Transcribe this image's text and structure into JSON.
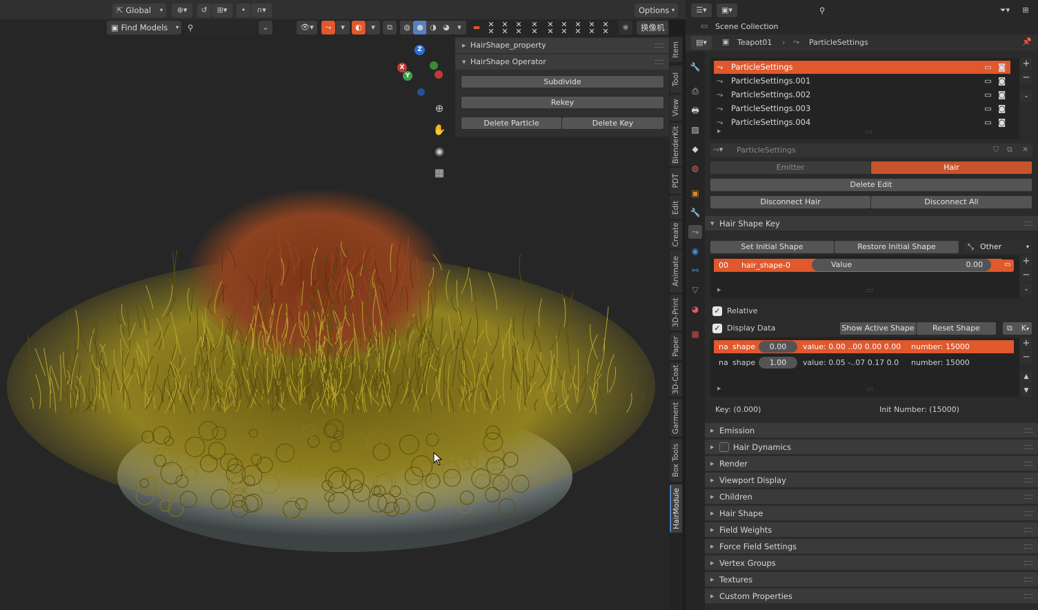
{
  "viewport_header": {
    "orientation": "Global",
    "options": "Options",
    "find_models": "Find Models",
    "camera_label": "换像机"
  },
  "npanel": {
    "sub1": "HairShape_property",
    "sub2": "HairShape Operator",
    "subdivide": "Subdivide",
    "rekey": "Rekey",
    "delete_particle": "Delete Particle",
    "delete_key": "Delete Key"
  },
  "gizmo": {
    "z": "Z",
    "x": "X",
    "y": "Y"
  },
  "side_tabs": [
    "Item",
    "Tool",
    "View",
    "BlenderKit",
    "PDT",
    "Edit",
    "Create",
    "Animate",
    "3D-Print",
    "Paper",
    "3D-Coat",
    "Garment",
    "Box Tools",
    "HairModule"
  ],
  "outliner": {
    "scene_collection": "Scene Collection"
  },
  "breadcrumb": {
    "object": "Teapot01",
    "settings": "ParticleSettings"
  },
  "particle_list": [
    {
      "name": "ParticleSettings"
    },
    {
      "name": "ParticleSettings.001"
    },
    {
      "name": "ParticleSettings.002"
    },
    {
      "name": "ParticleSettings.003"
    },
    {
      "name": "ParticleSettings.004"
    }
  ],
  "datablock": {
    "name": "ParticleSettings"
  },
  "type_tabs": {
    "emitter": "Emitter",
    "hair": "Hair"
  },
  "buttons": {
    "delete_edit": "Delete Edit",
    "disconnect_hair": "Disconnect Hair",
    "disconnect_all": "Disconnect All"
  },
  "hair_shape_key": {
    "title": "Hair Shape Key",
    "set_initial": "Set Initial Shape",
    "restore_initial": "Restore Initial Shape",
    "other": "Other",
    "key_index": "00",
    "key_name": "hair_shape-0",
    "value_label": "Value",
    "value": "0.00",
    "relative": "Relative",
    "display_data": "Display Data",
    "show_active": "Show Active Shape",
    "reset_shape": "Reset Shape",
    "k_label": "K",
    "rows": [
      {
        "na": "na",
        "shape": "shape",
        "num": "0.00",
        "value": "value:  0.00  ..00  0.00  0.00",
        "number": "number: 15000"
      },
      {
        "na": "na",
        "shape": "shape",
        "num": "1.00",
        "value": "value:  0.05  -..07  0.17  0.0",
        "number": "number: 15000"
      }
    ],
    "key_info": "Key: (0.000)",
    "init_number": "Init Number: (15000)"
  },
  "sections": [
    "Emission",
    "Hair Dynamics",
    "Render",
    "Viewport Display",
    "Children",
    "Hair Shape",
    "Field Weights",
    "Force Field Settings",
    "Vertex Groups",
    "Textures",
    "Custom Properties"
  ],
  "colors": {
    "accent": "#e0582c",
    "hair_yellow": "#9a8a1c",
    "hair_red": "#8a3a18"
  }
}
